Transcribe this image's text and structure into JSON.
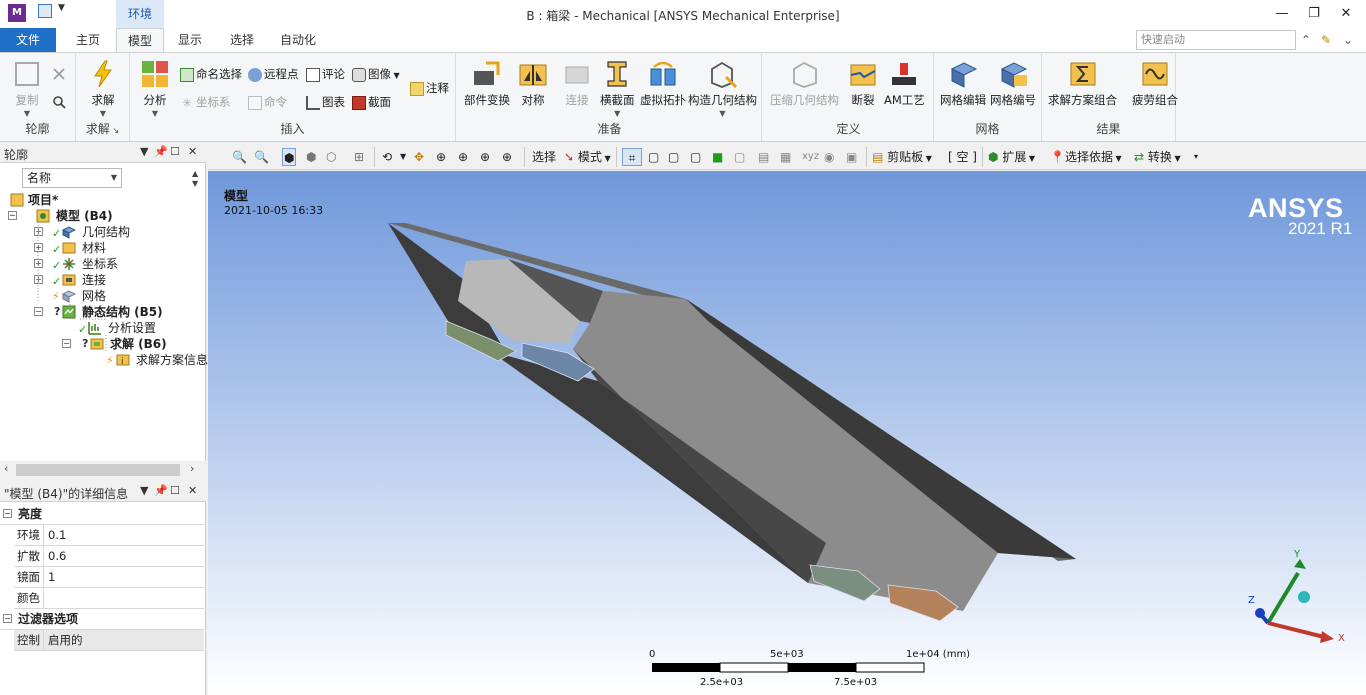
{
  "window": {
    "app_badge": "M",
    "context_tab_group": "环境",
    "title": "B : 箱梁 - Mechanical [ANSYS Mechanical Enterprise]"
  },
  "tabs": {
    "file": "文件",
    "items": [
      "主页",
      "模型",
      "显示",
      "选择",
      "自动化"
    ],
    "active": "模型",
    "quick_launch_placeholder": "快速启动"
  },
  "ribbon": {
    "outline_group": {
      "label": "轮廓",
      "copy": "复制"
    },
    "solve_group": {
      "label": "求解",
      "solve": "求解"
    },
    "insert_group": {
      "label": "插入",
      "analysis": "分析",
      "named_selection": "命名选择",
      "remote_point": "远程点",
      "comment": "评论",
      "image": "图像",
      "coordinate_system": "坐标系",
      "command": "命令",
      "chart": "图表",
      "section": "截面",
      "annotation": "注释"
    },
    "prepare_group": {
      "label": "准备",
      "part_transform": "部件变换",
      "symmetry": "对称",
      "connection": "连接",
      "cross_section": "横截面",
      "virtual_topology": "虚拟拓扑",
      "construction_geometry": "构造几何结构"
    },
    "define_group": {
      "label": "定义",
      "condensed_geometry": "压缩几何结构",
      "fracture": "断裂",
      "am_process": "AM工艺"
    },
    "mesh_group": {
      "label": "网格",
      "mesh_edit": "网格编辑",
      "mesh_numbering": "网格编号"
    },
    "results_group": {
      "label": "结果",
      "solution_combination": "求解方案组合",
      "fatigue_combination": "疲劳组合"
    }
  },
  "outline": {
    "title": "轮廓",
    "filter_value": "名称",
    "tree": [
      {
        "label": "项目*",
        "bold": true
      },
      {
        "label": "模型 (B4)",
        "bold": true
      },
      {
        "label": "几何结构"
      },
      {
        "label": "材料"
      },
      {
        "label": "坐标系"
      },
      {
        "label": "连接"
      },
      {
        "label": "网格"
      },
      {
        "label": "静态结构 (B5)",
        "bold": true
      },
      {
        "label": "分析设置"
      },
      {
        "label": "求解 (B6)",
        "bold": true
      },
      {
        "label": "求解方案信息"
      }
    ]
  },
  "details": {
    "title": "\"模型 (B4)\"的详细信息",
    "sections": [
      {
        "label": "亮度",
        "rows": [
          {
            "key": "环境",
            "value": "0.1"
          },
          {
            "key": "扩散",
            "value": "0.6"
          },
          {
            "key": "镜面",
            "value": "1"
          },
          {
            "key": "颜色",
            "value": ""
          }
        ]
      },
      {
        "label": "过滤器选项",
        "rows": [
          {
            "key": "控制",
            "value": "启用的"
          }
        ]
      }
    ]
  },
  "graphics_toolbar": {
    "select": "选择",
    "mode": "模式",
    "clipboard": "剪贴板",
    "empty": "[ 空 ]",
    "extend": "扩展",
    "select_by": "选择依据",
    "convert": "转换"
  },
  "viewport": {
    "title": "模型",
    "timestamp": "2021-10-05 16:33",
    "logo": "ANSYS",
    "version": "2021 R1",
    "scale": {
      "top_labels": [
        "0",
        "5e+03",
        "1e+04 (mm)"
      ],
      "bottom_labels": [
        "2.5e+03",
        "7.5e+03"
      ]
    },
    "triad": {
      "x": "X",
      "y": "Y",
      "z": "Z"
    }
  },
  "colors": {
    "file_tab": "#1f6fc6",
    "viewport_top": "#6f98db",
    "viewport_bottom": "#ffffff",
    "beam_face": "#8c8c8c",
    "beam_dark": "#3c3c3c"
  }
}
